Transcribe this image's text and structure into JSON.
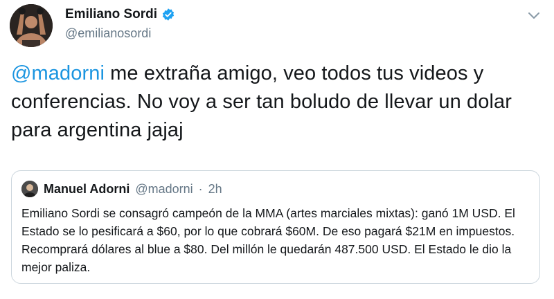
{
  "author": {
    "display_name": "Emiliano Sordi",
    "handle": "@emilianosordi"
  },
  "tweet": {
    "mention": "@madorni",
    "text": " me extraña amigo, veo todos tus videos y conferencias. No voy a ser tan boludo de llevar un dolar para argentina jajaj"
  },
  "quoted": {
    "display_name": "Manuel Adorni",
    "handle": "@madorni",
    "separator": "·",
    "time": "2h",
    "text": "Emiliano Sordi se consagró campeón de la MMA (artes marciales mixtas): ganó 1M USD. El Estado se lo pesificará a $60, por lo que cobrará $60M. De eso pagará $21M en impuestos. Recomprará dólares al blue a $80. Del millón le quedarán 487.500 USD. El Estado le dio la mejor paliza."
  },
  "icons": {
    "verified": "verified-badge-icon",
    "menu": "chevron-down-icon"
  },
  "colors": {
    "link": "#1b95e0",
    "verified": "#1da1f2",
    "secondary_text": "#657786",
    "border": "#ccd6dd"
  }
}
